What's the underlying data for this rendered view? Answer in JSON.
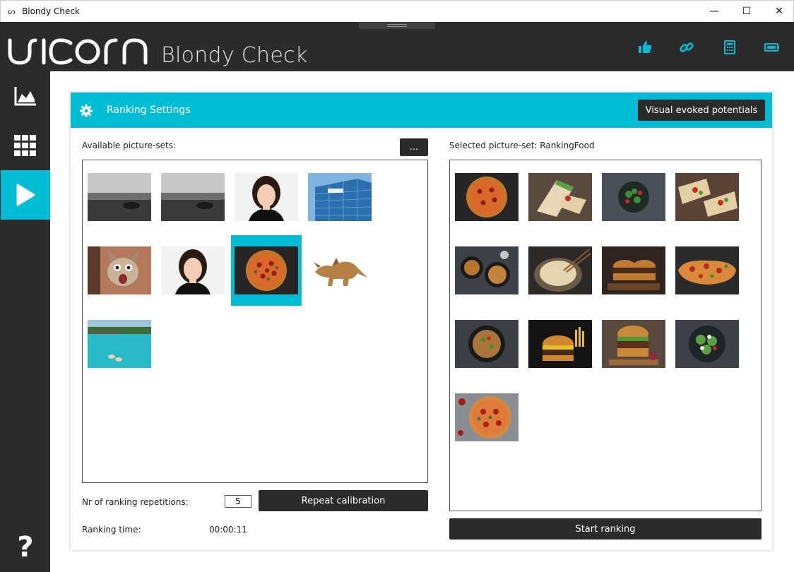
{
  "window": {
    "title": "Blondy Check",
    "app_icon": "ᔕ",
    "minimize_glyph": "—",
    "maximize_glyph": "☐",
    "close_glyph": "✕"
  },
  "header": {
    "logo_text": "unicorn",
    "app_name": "Blondy Check",
    "icons": [
      "thumbs-up-icon",
      "link-icon",
      "calculator-icon",
      "battery-icon"
    ],
    "accent_color": "#00bcd4"
  },
  "sidebar": {
    "items": [
      {
        "name": "chart-icon",
        "active": false
      },
      {
        "name": "grid-icon",
        "active": false
      },
      {
        "name": "play-icon",
        "active": true
      }
    ],
    "help_label": "?"
  },
  "panel": {
    "title": "Ranking Settings",
    "vep_button": "Visual evoked potentials",
    "available_label": "Available picture-sets:",
    "more_button": "...",
    "selected_label": "Selected picture-set: RankingFood",
    "available_sets": [
      {
        "name": "bw-beach-boat"
      },
      {
        "name": "bw-beach-boat-2"
      },
      {
        "name": "woman-portrait"
      },
      {
        "name": "office-building"
      },
      {
        "name": "kitten"
      },
      {
        "name": "woman-portrait-2"
      },
      {
        "name": "pizza",
        "selected": true
      },
      {
        "name": "dinosaur-toy"
      },
      {
        "name": "tropical-lagoon"
      }
    ],
    "selected_pictures": [
      "pizza",
      "burrito",
      "salad-bowl",
      "wraps",
      "noodle-bowls",
      "pasta",
      "burgers",
      "flatbread-pizza",
      "noodle-bowl",
      "burger-fries",
      "burger-board",
      "green-salad",
      "pizza-2"
    ],
    "repetitions_label": "Nr of ranking repetitions:",
    "repetitions_value": "5",
    "repeat_button": "Repeat calibration",
    "time_label": "Ranking time:",
    "time_value": "00:00:11",
    "start_button": "Start ranking"
  }
}
